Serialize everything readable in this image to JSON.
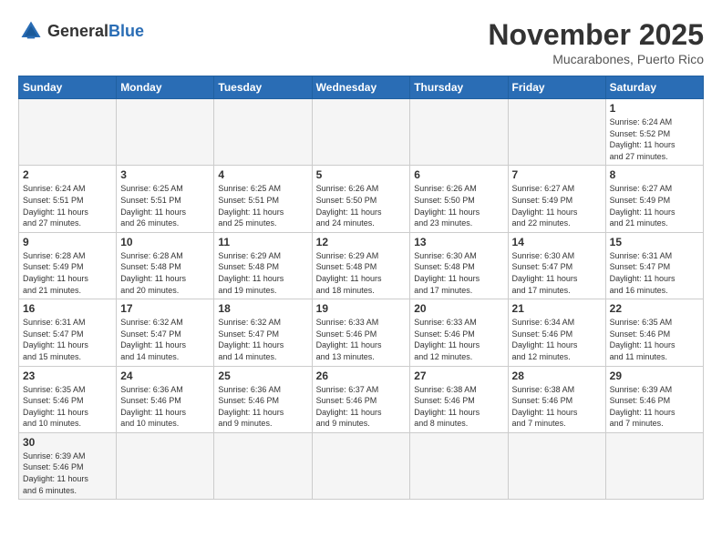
{
  "header": {
    "logo_general": "General",
    "logo_blue": "Blue",
    "month_title": "November 2025",
    "location": "Mucarabones, Puerto Rico"
  },
  "weekdays": [
    "Sunday",
    "Monday",
    "Tuesday",
    "Wednesday",
    "Thursday",
    "Friday",
    "Saturday"
  ],
  "days": [
    {
      "num": "",
      "info": "",
      "empty": true
    },
    {
      "num": "",
      "info": "",
      "empty": true
    },
    {
      "num": "",
      "info": "",
      "empty": true
    },
    {
      "num": "",
      "info": "",
      "empty": true
    },
    {
      "num": "",
      "info": "",
      "empty": true
    },
    {
      "num": "",
      "info": "",
      "empty": true
    },
    {
      "num": "1",
      "info": "Sunrise: 6:24 AM\nSunset: 5:52 PM\nDaylight: 11 hours\nand 27 minutes."
    },
    {
      "num": "2",
      "info": "Sunrise: 6:24 AM\nSunset: 5:51 PM\nDaylight: 11 hours\nand 27 minutes."
    },
    {
      "num": "3",
      "info": "Sunrise: 6:25 AM\nSunset: 5:51 PM\nDaylight: 11 hours\nand 26 minutes."
    },
    {
      "num": "4",
      "info": "Sunrise: 6:25 AM\nSunset: 5:51 PM\nDaylight: 11 hours\nand 25 minutes."
    },
    {
      "num": "5",
      "info": "Sunrise: 6:26 AM\nSunset: 5:50 PM\nDaylight: 11 hours\nand 24 minutes."
    },
    {
      "num": "6",
      "info": "Sunrise: 6:26 AM\nSunset: 5:50 PM\nDaylight: 11 hours\nand 23 minutes."
    },
    {
      "num": "7",
      "info": "Sunrise: 6:27 AM\nSunset: 5:49 PM\nDaylight: 11 hours\nand 22 minutes."
    },
    {
      "num": "8",
      "info": "Sunrise: 6:27 AM\nSunset: 5:49 PM\nDaylight: 11 hours\nand 21 minutes."
    },
    {
      "num": "9",
      "info": "Sunrise: 6:28 AM\nSunset: 5:49 PM\nDaylight: 11 hours\nand 21 minutes."
    },
    {
      "num": "10",
      "info": "Sunrise: 6:28 AM\nSunset: 5:48 PM\nDaylight: 11 hours\nand 20 minutes."
    },
    {
      "num": "11",
      "info": "Sunrise: 6:29 AM\nSunset: 5:48 PM\nDaylight: 11 hours\nand 19 minutes."
    },
    {
      "num": "12",
      "info": "Sunrise: 6:29 AM\nSunset: 5:48 PM\nDaylight: 11 hours\nand 18 minutes."
    },
    {
      "num": "13",
      "info": "Sunrise: 6:30 AM\nSunset: 5:48 PM\nDaylight: 11 hours\nand 17 minutes."
    },
    {
      "num": "14",
      "info": "Sunrise: 6:30 AM\nSunset: 5:47 PM\nDaylight: 11 hours\nand 17 minutes."
    },
    {
      "num": "15",
      "info": "Sunrise: 6:31 AM\nSunset: 5:47 PM\nDaylight: 11 hours\nand 16 minutes."
    },
    {
      "num": "16",
      "info": "Sunrise: 6:31 AM\nSunset: 5:47 PM\nDaylight: 11 hours\nand 15 minutes."
    },
    {
      "num": "17",
      "info": "Sunrise: 6:32 AM\nSunset: 5:47 PM\nDaylight: 11 hours\nand 14 minutes."
    },
    {
      "num": "18",
      "info": "Sunrise: 6:32 AM\nSunset: 5:47 PM\nDaylight: 11 hours\nand 14 minutes."
    },
    {
      "num": "19",
      "info": "Sunrise: 6:33 AM\nSunset: 5:46 PM\nDaylight: 11 hours\nand 13 minutes."
    },
    {
      "num": "20",
      "info": "Sunrise: 6:33 AM\nSunset: 5:46 PM\nDaylight: 11 hours\nand 12 minutes."
    },
    {
      "num": "21",
      "info": "Sunrise: 6:34 AM\nSunset: 5:46 PM\nDaylight: 11 hours\nand 12 minutes."
    },
    {
      "num": "22",
      "info": "Sunrise: 6:35 AM\nSunset: 5:46 PM\nDaylight: 11 hours\nand 11 minutes."
    },
    {
      "num": "23",
      "info": "Sunrise: 6:35 AM\nSunset: 5:46 PM\nDaylight: 11 hours\nand 10 minutes."
    },
    {
      "num": "24",
      "info": "Sunrise: 6:36 AM\nSunset: 5:46 PM\nDaylight: 11 hours\nand 10 minutes."
    },
    {
      "num": "25",
      "info": "Sunrise: 6:36 AM\nSunset: 5:46 PM\nDaylight: 11 hours\nand 9 minutes."
    },
    {
      "num": "26",
      "info": "Sunrise: 6:37 AM\nSunset: 5:46 PM\nDaylight: 11 hours\nand 9 minutes."
    },
    {
      "num": "27",
      "info": "Sunrise: 6:38 AM\nSunset: 5:46 PM\nDaylight: 11 hours\nand 8 minutes."
    },
    {
      "num": "28",
      "info": "Sunrise: 6:38 AM\nSunset: 5:46 PM\nDaylight: 11 hours\nand 7 minutes."
    },
    {
      "num": "29",
      "info": "Sunrise: 6:39 AM\nSunset: 5:46 PM\nDaylight: 11 hours\nand 7 minutes."
    },
    {
      "num": "30",
      "info": "Sunrise: 6:39 AM\nSunset: 5:46 PM\nDaylight: 11 hours\nand 6 minutes."
    },
    {
      "num": "",
      "info": "",
      "empty": true
    },
    {
      "num": "",
      "info": "",
      "empty": true
    },
    {
      "num": "",
      "info": "",
      "empty": true
    },
    {
      "num": "",
      "info": "",
      "empty": true
    },
    {
      "num": "",
      "info": "",
      "empty": true
    },
    {
      "num": "",
      "info": "",
      "empty": true
    }
  ]
}
